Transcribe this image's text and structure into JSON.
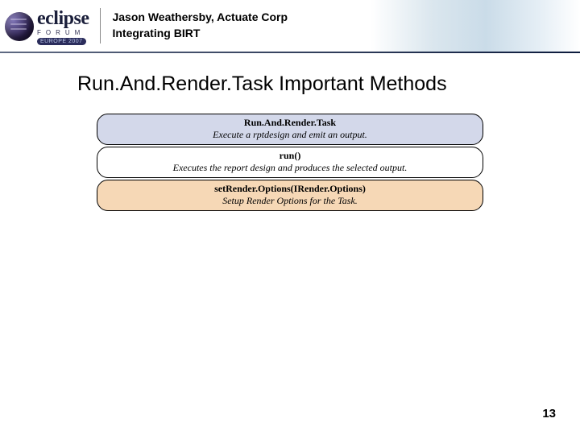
{
  "header": {
    "author_line": "Jason Weathersby, Actuate Corp",
    "subtitle": "Integrating BIRT",
    "logo_word": "eclipse",
    "logo_sub": "FORUM",
    "logo_year": "EUROPE 2007"
  },
  "slide": {
    "title": "Run.And.Render.Task Important Methods",
    "box_header": {
      "name": "Run.And.Render.Task",
      "desc": "Execute a rptdesign and emit an output."
    },
    "methods": [
      {
        "name": "run()",
        "desc": "Executes the report design and produces the selected output."
      },
      {
        "name": "setRender.Options(IRender.Options)",
        "desc": "Setup Render Options for the Task."
      }
    ],
    "page_number": "13"
  }
}
